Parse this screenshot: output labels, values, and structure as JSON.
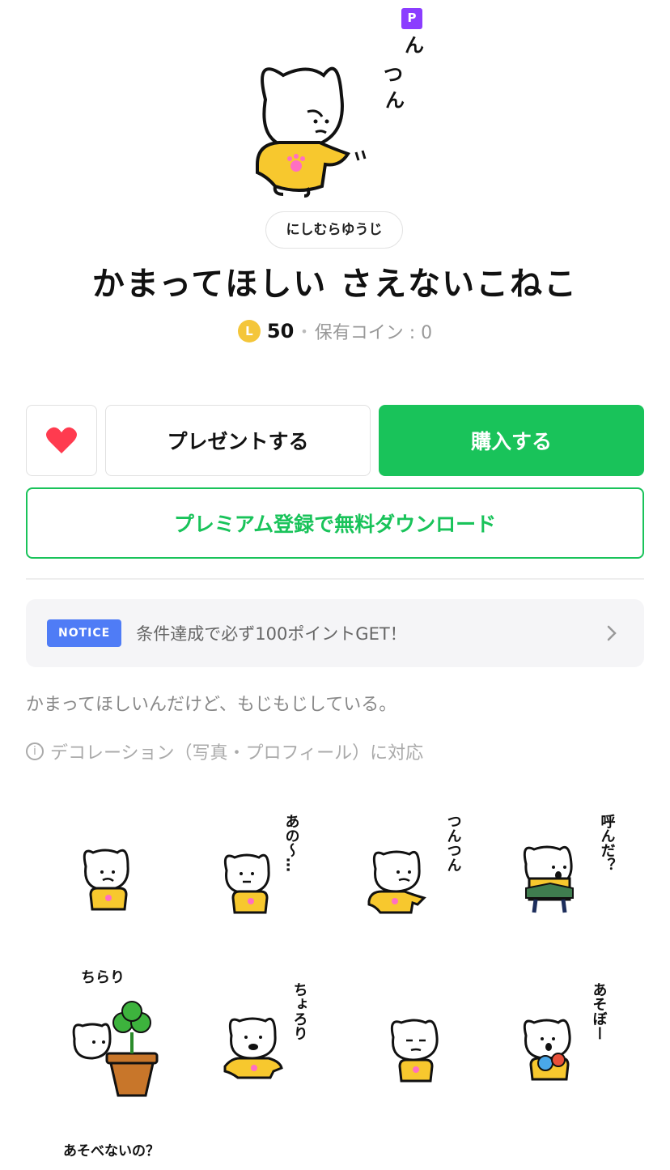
{
  "hero": {
    "premium_badge": "P",
    "caption": "つんつん"
  },
  "creator": "にしむらゆうじ",
  "title": "かまってほしい さえないこねこ",
  "price": {
    "coin_symbol": "L",
    "amount": "50",
    "separator": "•",
    "owned_label": "保有コイン : 0"
  },
  "actions": {
    "like_icon": "heart-icon",
    "gift_label": "プレゼントする",
    "buy_label": "購入する",
    "premium_label": "プレミアム登録で無料ダウンロード"
  },
  "notice": {
    "badge": "NOTICE",
    "text": "条件達成で必ず100ポイントGET！"
  },
  "description": "かまってほしいんだけど、もじもじしている。",
  "decoration": {
    "icon": "i",
    "text": "デコレーション（写真・プロフィール）に対応"
  },
  "stickers": [
    {
      "caption": ""
    },
    {
      "caption": "あの〜…"
    },
    {
      "caption": "つんつん"
    },
    {
      "caption": "呼んだ？"
    },
    {
      "caption": "ちらり"
    },
    {
      "caption": "ちょろり"
    },
    {
      "caption": ""
    },
    {
      "caption": "あそぼー"
    },
    {
      "caption": "あそべないの？"
    }
  ],
  "colors": {
    "accent": "#19c35a",
    "heart": "#ff3b4f",
    "notice": "#4f7cf6",
    "coin": "#f4c63a",
    "premium_badge": "#8b3dff",
    "shirt": "#f7c82e"
  }
}
